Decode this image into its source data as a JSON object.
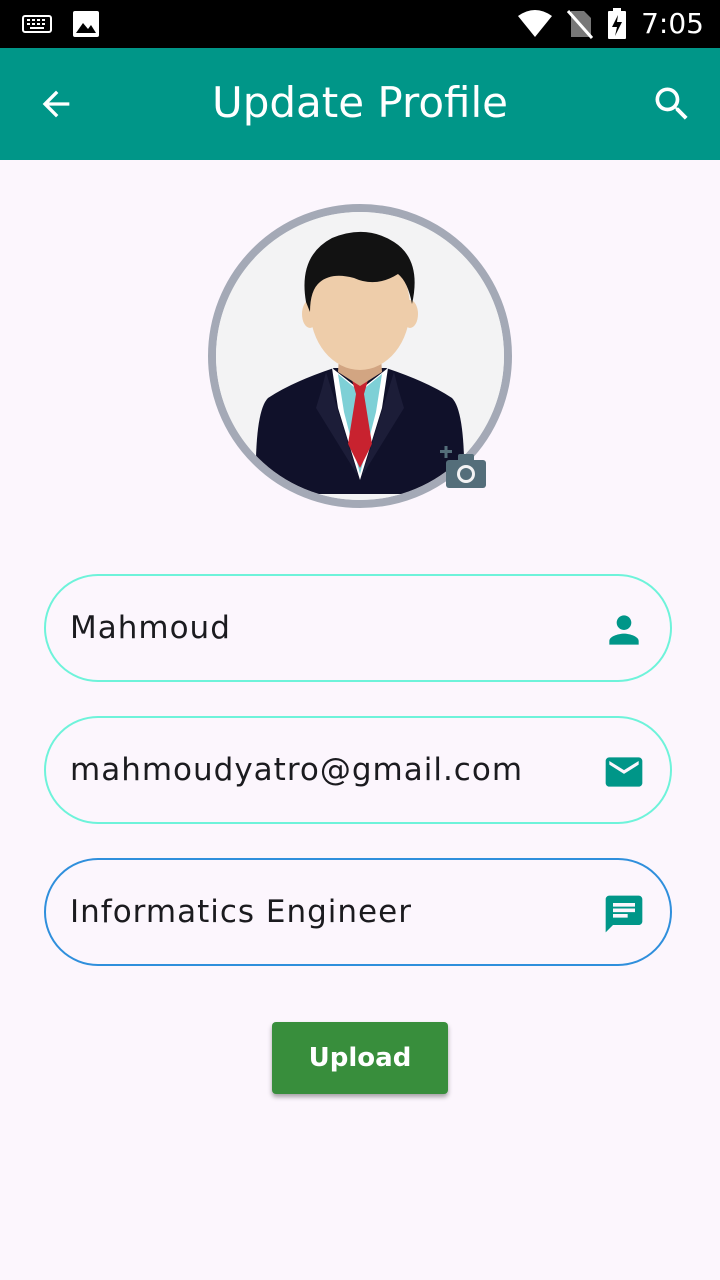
{
  "status_bar": {
    "time": "7:05",
    "icons": [
      "keyboard-icon",
      "image-icon",
      "wifi-icon",
      "no-sim-icon",
      "battery-charging-icon"
    ]
  },
  "app_bar": {
    "title": "Update Profile",
    "back_icon": "arrow-back-icon",
    "search_icon": "search-icon",
    "color": "#009688"
  },
  "avatar": {
    "icon": "person-avatar",
    "camera_icon": "add-photo-camera-icon"
  },
  "form": {
    "name": {
      "value": "Mahmoud",
      "icon": "person-icon"
    },
    "email": {
      "value": "mahmoudyatro@gmail.com",
      "icon": "mail-icon"
    },
    "bio": {
      "value": "Informatics Engineer",
      "icon": "message-icon"
    }
  },
  "upload_button": {
    "label": "Upload",
    "color": "#388e3c"
  }
}
